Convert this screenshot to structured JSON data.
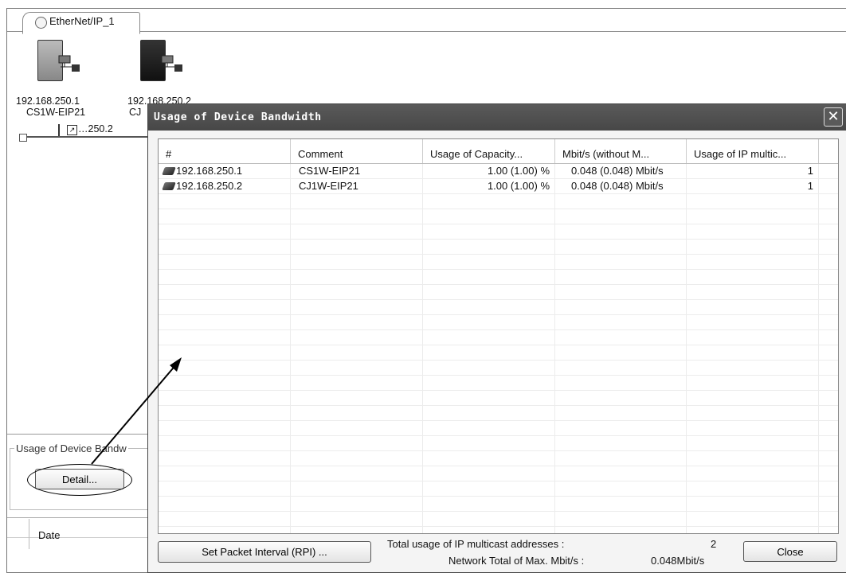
{
  "window": {
    "tab_label": "EtherNet/IP_1",
    "devices": [
      {
        "ip": "192.168.250.1",
        "model": "CS1W-EIP21"
      },
      {
        "ip": "192.168.250.2",
        "model": "CJ",
        "ip_visible": "192.168.250.2",
        "short_label": "…250.2"
      }
    ],
    "group_label": "Usage of Device Bandwidth",
    "group_label_visible": "Usage of Device Bandw",
    "detail_button": "Detail...",
    "grid_column": "Date"
  },
  "dialog": {
    "title": "Usage of Device Bandwidth",
    "close_glyph": "✕",
    "columns": [
      "#",
      "Comment",
      "Usage of Capacity...",
      "Mbit/s (without M...",
      "Usage of IP multic..."
    ],
    "rows": [
      {
        "ip": "192.168.250.1",
        "comment": "CS1W-EIP21",
        "usage": "1.00 (1.00) %",
        "mbits": "0.048 (0.048) Mbit/s",
        "multicast": "1"
      },
      {
        "ip": "192.168.250.2",
        "comment": "CJ1W-EIP21",
        "usage": "1.00 (1.00) %",
        "mbits": "0.048 (0.048) Mbit/s",
        "multicast": "1"
      }
    ],
    "set_rpi_button": "Set Packet Interval (RPI) ...",
    "total_multicast_label": "Total usage of IP multicast addresses :",
    "total_multicast_value": "2",
    "network_total_label": "Network Total of Max. Mbit/s :",
    "network_total_value": "0.048Mbit/s",
    "close_button": "Close"
  }
}
